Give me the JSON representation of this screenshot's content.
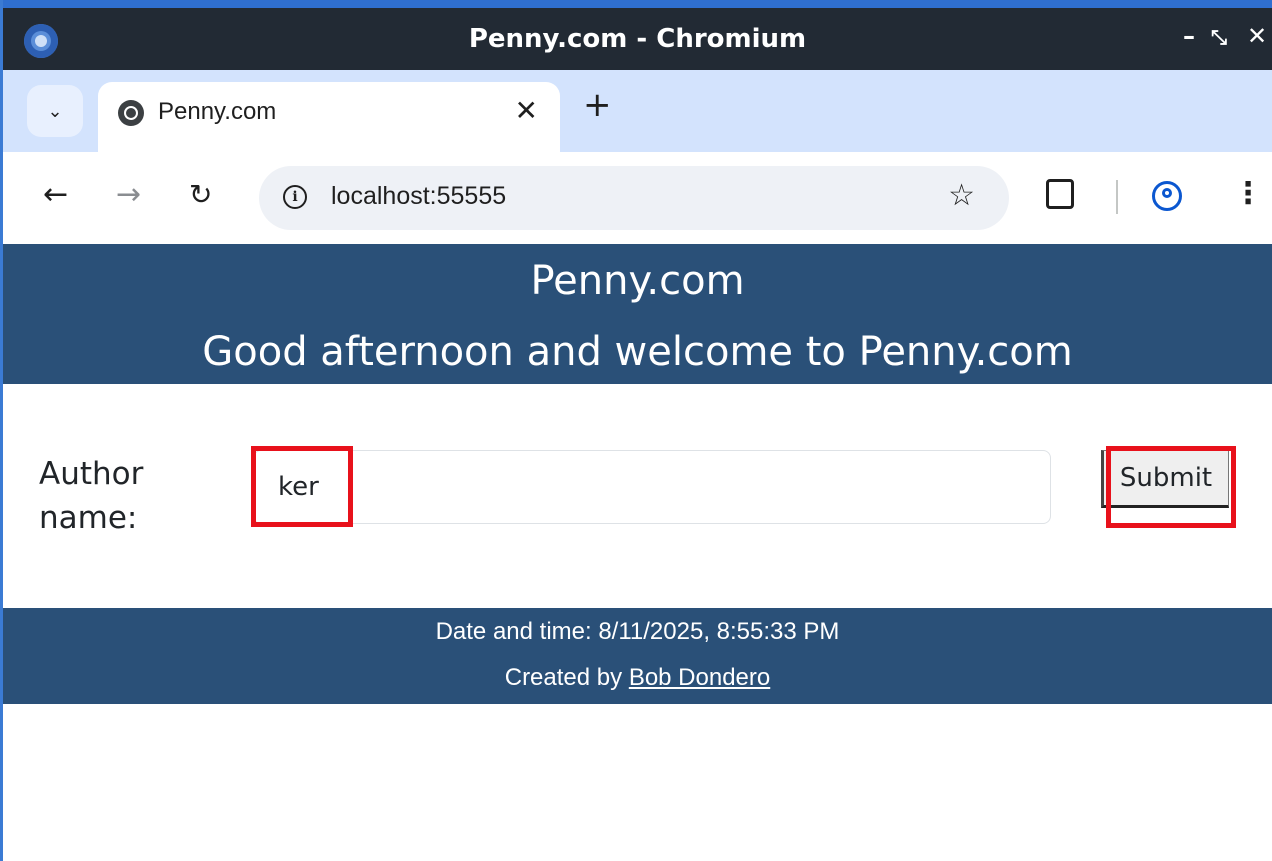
{
  "window": {
    "title": "Penny.com - Chromium",
    "controls": [
      "–",
      "⤡",
      "✕"
    ]
  },
  "tabs": [
    {
      "title": "Penny.com",
      "icon": "globe-icon",
      "active": true
    }
  ],
  "toolbar": {
    "url": "localhost:55555",
    "icons": [
      "back-icon",
      "forward-icon",
      "reload-icon",
      "info-icon",
      "star-icon",
      "extensions-icon",
      "profile-icon",
      "menu-icon"
    ]
  },
  "page": {
    "header": {
      "site_title": "Penny.com",
      "welcome": "Good afternoon and welcome to Penny.com"
    },
    "form": {
      "author_label": "Author name:",
      "author_value": "ker",
      "submit_label": "Submit"
    },
    "footer": {
      "datetime_line": "Date and time: 8/11/2025, 8:55:33 PM",
      "created_by_prefix": "Created by ",
      "author_link": "Bob Dondero"
    }
  },
  "colors": {
    "header_bg": "#2a5078",
    "highlight": "#e8111b",
    "tabstrip_bg": "#d3e3fd",
    "titlebar_bg": "#222a34"
  }
}
